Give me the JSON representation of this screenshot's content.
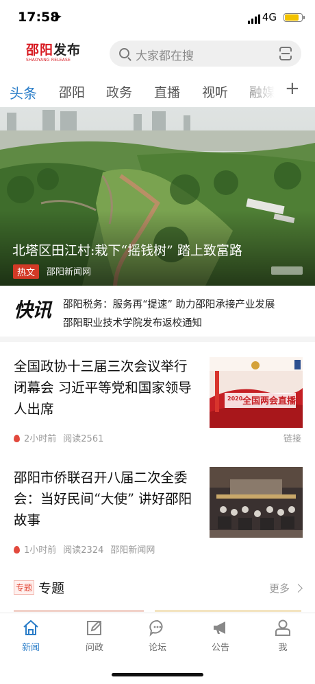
{
  "status_bar": {
    "time": "17:58",
    "network": "4G",
    "battery_level": 0.85
  },
  "header": {
    "logo_red": "邵阳",
    "logo_black": "发布",
    "logo_en": "SHAOYANG RELEASE",
    "search_placeholder": "大家都在搜"
  },
  "tabs": [
    "头条",
    "邵阳",
    "政务",
    "直播",
    "视听",
    "融媒"
  ],
  "tabs_more": "+",
  "hero": {
    "title": "北塔区田江村:栽下“摇钱树” 踏上致富路",
    "badge": "热文",
    "source": "邵阳新闻网"
  },
  "flash": {
    "title": "快讯",
    "items": [
      "邵阳税务：服务再“提速” 助力邵阳承接产业发展",
      "邵阳职业技术学院发布返校通知"
    ]
  },
  "news": [
    {
      "title": "全国政协十三届三次会议举行闭幕会 习近平等党和国家领导人出席",
      "time": "2小时前",
      "reads": "阅读2561",
      "source": "",
      "tag": "链接",
      "thumb_caption_year": "2020",
      "thumb_caption": "全国两会直播"
    },
    {
      "title": "邵阳市侨联召开八届二次全委会：当好民间“大使” 讲好邵阳故事",
      "time": "1小时前",
      "reads": "阅读2324",
      "source": "邵阳新闻网",
      "tag": ""
    }
  ],
  "special": {
    "tag": "专题",
    "title": "专题",
    "more": "更多"
  },
  "bottom_nav": [
    {
      "label": "新闻",
      "icon": "home-icon",
      "active": true
    },
    {
      "label": "问政",
      "icon": "edit-icon",
      "active": false
    },
    {
      "label": "论坛",
      "icon": "chat-icon",
      "active": false
    },
    {
      "label": "公告",
      "icon": "megaphone-icon",
      "active": false
    },
    {
      "label": "我",
      "icon": "user-icon",
      "active": false
    }
  ],
  "colors": {
    "accent": "#2a7dc8",
    "brand_red": "#d71920",
    "badge_red": "#d23a26"
  }
}
